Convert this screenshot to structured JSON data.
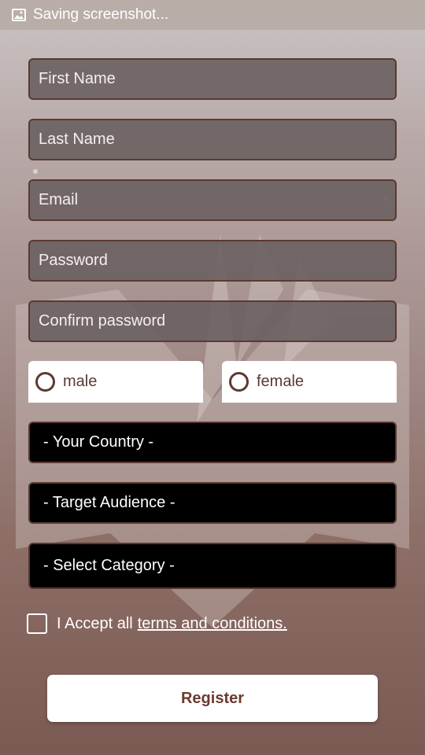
{
  "status_bar": {
    "icon": "image-icon",
    "text": "Saving screenshot..."
  },
  "form": {
    "first_name_placeholder": "First Name",
    "last_name_placeholder": "Last Name",
    "email_placeholder": "Email",
    "password_placeholder": "Password",
    "confirm_password_placeholder": "Confirm password",
    "gender": {
      "male_label": "male",
      "female_label": "female"
    },
    "country_select": "- Your Country -",
    "audience_select": "- Target Audience -",
    "category_select": "- Select Category -",
    "terms": {
      "prefix": "I Accept all",
      "link": "terms and conditions."
    },
    "register_label": "Register"
  },
  "colors": {
    "accent": "#5a3a30",
    "register_text": "#6b3a30",
    "field_bg": "#69605f",
    "select_bg": "#000000"
  }
}
